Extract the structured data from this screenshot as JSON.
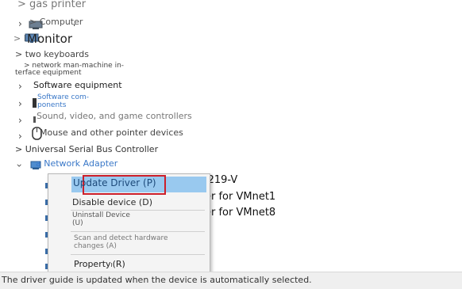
{
  "tree": {
    "gas_printer": "> gas printer",
    "computer": "> Computer",
    "computer_suffix": ",",
    "monitor_prefix": "> P",
    "monitor": "Monitor",
    "keyboards": "> two keyboards",
    "network_hmi_line1": "> network man-machine in-",
    "network_hmi_line2": "terface equipment",
    "software_equipment": "Software equipment",
    "software_components_line1": "Software com-",
    "software_components_line2": "ponents",
    "sound": "Sound, video, and game controllers",
    "mouse": "Mouse and other pointer devices",
    "mouse_prefix": "0",
    "usb": "> Universal Serial Bus Controller",
    "network_adapter": "a Network Adapter",
    "adapter_items": [
      "l219-V",
      "er for VMnet1",
      "er for VMnet8"
    ]
  },
  "context_menu": {
    "update_driver": "Update Driver (P)",
    "disable_device": "Disable device (D)",
    "uninstall_line1": "Uninstall Device",
    "uninstall_line2": "(U)",
    "scan_line1": "Scan and detect hardware",
    "scan_line2": "changes (A)",
    "property": "Property",
    "property_sub": "I",
    "property_key": "(R)"
  },
  "status_bar": {
    "text": "The driver guide is updated when the device is automatically selected."
  },
  "colors": {
    "highlight": "#99c9ef",
    "highlight_border": "#cc1f2a",
    "link_blue": "#3a78c8"
  },
  "icons": [
    "printer-icon",
    "computer-icon",
    "monitor-icon",
    "keyboard-icon",
    "network-device-icon",
    "software-icon",
    "speaker-icon",
    "mouse-icon",
    "usb-icon",
    "network-adapter-icon"
  ]
}
